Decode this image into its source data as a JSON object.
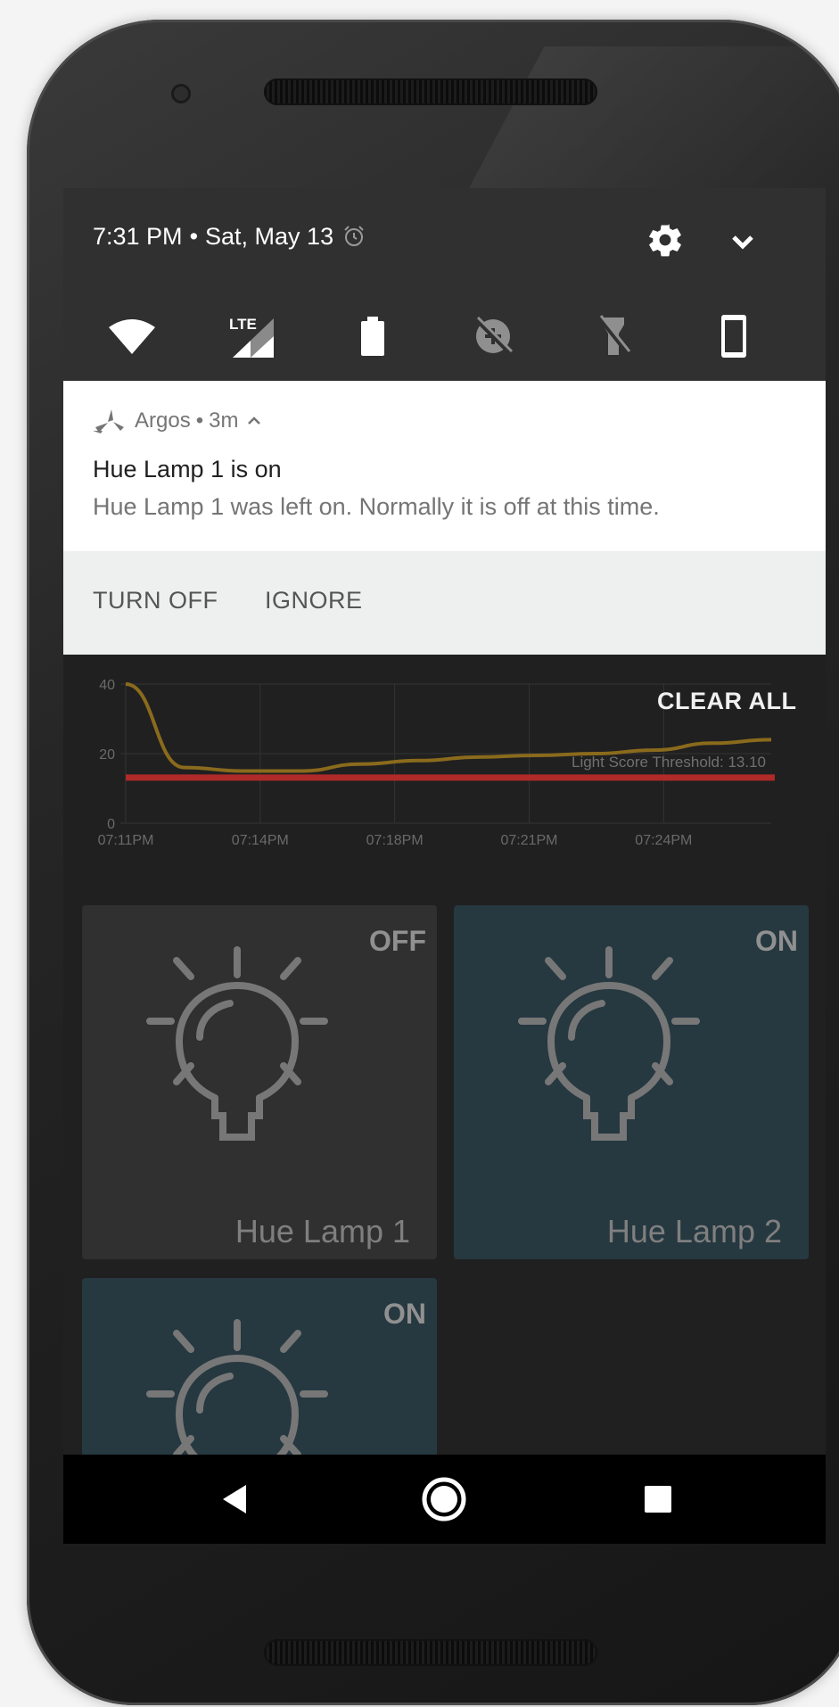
{
  "status_bar": {
    "time": "7:31 PM",
    "separator": "•",
    "date": "Sat, May 13",
    "alarm_icon": "alarm-icon",
    "settings_icon": "gear-icon",
    "expand_icon": "chevron-down-icon"
  },
  "quick_settings": [
    {
      "name": "wifi",
      "icon": "wifi-icon"
    },
    {
      "name": "cellular",
      "icon": "signal-lte-icon",
      "label": "LTE"
    },
    {
      "name": "battery",
      "icon": "battery-icon"
    },
    {
      "name": "data-saver",
      "icon": "data-saver-off-icon"
    },
    {
      "name": "flashlight",
      "icon": "flashlight-off-icon"
    },
    {
      "name": "rotation",
      "icon": "phone-portrait-icon"
    }
  ],
  "notification": {
    "app_icon": "argos-logo-icon",
    "app": "Argos",
    "separator": "•",
    "time": "3m",
    "title": "Hue Lamp 1 is on",
    "text": "Hue Lamp 1 was left on. Normally it is off at this time.",
    "actions": [
      "TURN OFF",
      "IGNORE"
    ]
  },
  "clear_all": "CLEAR ALL",
  "chart_data": {
    "type": "line",
    "title": "",
    "xlabel": "",
    "ylabel": "",
    "x": [
      "07:11PM",
      "07:12PM",
      "07:13PM",
      "07:14PM",
      "07:15PM",
      "07:16PM",
      "07:18PM",
      "07:20PM",
      "07:21PM",
      "07:22PM",
      "07:24PM",
      "07:26PM"
    ],
    "x_ticks": [
      "07:11PM",
      "07:14PM",
      "07:18PM",
      "07:21PM",
      "07:24PM"
    ],
    "y_ticks": [
      "0",
      "20",
      "40"
    ],
    "ylim": [
      0,
      40
    ],
    "series": [
      {
        "values": [
          40,
          16,
          15,
          15,
          17,
          18,
          19,
          19.5,
          20,
          21,
          23,
          24
        ],
        "color": "#8a6a1c"
      }
    ],
    "threshold": {
      "label": "Light Score Threshold: 13.10",
      "value": 13.1,
      "color": "#b02a2a"
    },
    "grid": true
  },
  "devices": [
    {
      "name": "Hue Lamp 1",
      "state": "OFF",
      "icon": "lightbulb-icon"
    },
    {
      "name": "Hue Lamp 2",
      "state": "ON",
      "icon": "lightbulb-icon"
    },
    {
      "name": "",
      "state": "ON",
      "icon": "lightbulb-icon"
    }
  ],
  "nav": {
    "back_icon": "back-triangle-icon",
    "home_icon": "home-circle-icon",
    "recents_icon": "recents-square-icon"
  }
}
